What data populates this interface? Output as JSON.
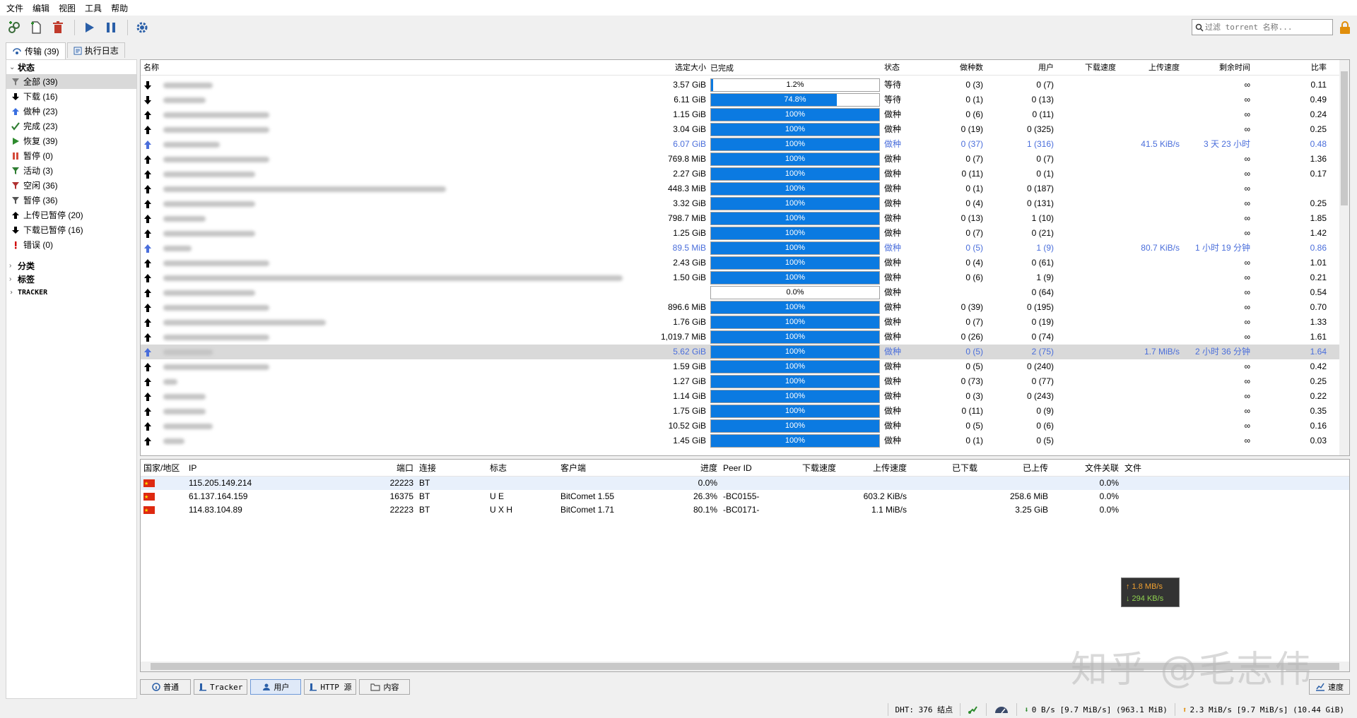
{
  "menu": [
    "文件",
    "编辑",
    "视图",
    "工具",
    "帮助"
  ],
  "toolbar": {
    "icons": [
      "add-link-icon",
      "add-file-icon",
      "delete-icon",
      "play-icon",
      "pause-icon",
      "gear-icon"
    ],
    "filter_placeholder": "过滤 torrent 名称..."
  },
  "top_tabs": [
    {
      "label": "传输 (39)",
      "icon": "transfer-icon"
    },
    {
      "label": "执行日志",
      "icon": "log-icon"
    }
  ],
  "sidebar": {
    "status_group": "状态",
    "status_items": [
      {
        "label": "全部 (39)",
        "icon": "filter-icon",
        "color": "#7a7a7a"
      },
      {
        "label": "下载 (16)",
        "icon": "download-arrow-icon",
        "color": "#000000"
      },
      {
        "label": "做种 (23)",
        "icon": "upload-arrow-icon",
        "color": "#3a6fe0"
      },
      {
        "label": "完成 (23)",
        "icon": "checkmark-icon",
        "color": "#2f7d32"
      },
      {
        "label": "恢复 (39)",
        "icon": "play-icon",
        "color": "#2e8b2e"
      },
      {
        "label": "暂停 (0)",
        "icon": "pause-icon",
        "color": "#d44a3a"
      },
      {
        "label": "活动 (3)",
        "icon": "filter-icon",
        "color": "#2e7d32"
      },
      {
        "label": "空闲 (36)",
        "icon": "filter-icon",
        "color": "#b03030"
      },
      {
        "label": "暂停 (36)",
        "icon": "filter-icon",
        "color": "#555555"
      },
      {
        "label": "上传已暂停 (20)",
        "icon": "upload-arrow-icon",
        "color": "#000000"
      },
      {
        "label": "下载已暂停 (16)",
        "icon": "download-arrow-icon",
        "color": "#000000"
      },
      {
        "label": "错误 (0)",
        "icon": "error-icon",
        "color": "#d00000"
      }
    ],
    "groups": [
      "分类",
      "标签",
      "TRACKER"
    ]
  },
  "torrent_table": {
    "columns": [
      "名称",
      "选定大小",
      "已完成",
      "状态",
      "做种数",
      "用户",
      "下载速度",
      "上传速度",
      "剩余时间",
      "比率"
    ],
    "rows": [
      {
        "dir": "down",
        "size": "3.57 GiB",
        "progress": 0.012,
        "progress_label": "1.2%",
        "state": "等待",
        "seeds": "0 (3)",
        "peers": "0 (7)",
        "dl": "",
        "ul": "",
        "eta": "∞",
        "ratio": "0.11",
        "active": false,
        "selected": false
      },
      {
        "dir": "down",
        "size": "6.11 GiB",
        "progress": 0.748,
        "progress_label": "74.8%",
        "state": "等待",
        "seeds": "0 (1)",
        "peers": "0 (13)",
        "dl": "",
        "ul": "",
        "eta": "∞",
        "ratio": "0.49",
        "active": false,
        "selected": false
      },
      {
        "dir": "up",
        "size": "1.15 GiB",
        "progress": 1,
        "progress_label": "100%",
        "state": "做种",
        "seeds": "0 (6)",
        "peers": "0 (11)",
        "dl": "",
        "ul": "",
        "eta": "∞",
        "ratio": "0.24",
        "active": false,
        "selected": false
      },
      {
        "dir": "up",
        "size": "3.04 GiB",
        "progress": 1,
        "progress_label": "100%",
        "state": "做种",
        "seeds": "0 (19)",
        "peers": "0 (325)",
        "dl": "",
        "ul": "",
        "eta": "∞",
        "ratio": "0.25",
        "active": false,
        "selected": false
      },
      {
        "dir": "up",
        "size": "6.07 GiB",
        "progress": 1,
        "progress_label": "100%",
        "state": "做种",
        "seeds": "0 (37)",
        "peers": "1 (316)",
        "dl": "",
        "ul": "41.5 KiB/s",
        "eta": "3 天 23 小时",
        "ratio": "0.48",
        "active": true,
        "selected": false
      },
      {
        "dir": "up",
        "size": "769.8 MiB",
        "progress": 1,
        "progress_label": "100%",
        "state": "做种",
        "seeds": "0 (7)",
        "peers": "0 (7)",
        "dl": "",
        "ul": "",
        "eta": "∞",
        "ratio": "1.36",
        "active": false,
        "selected": false
      },
      {
        "dir": "up",
        "size": "2.27 GiB",
        "progress": 1,
        "progress_label": "100%",
        "state": "做种",
        "seeds": "0 (11)",
        "peers": "0 (1)",
        "dl": "",
        "ul": "",
        "eta": "∞",
        "ratio": "0.17",
        "active": false,
        "selected": false
      },
      {
        "dir": "up",
        "size": "448.3 MiB",
        "progress": 1,
        "progress_label": "100%",
        "state": "做种",
        "seeds": "0 (1)",
        "peers": "0 (187)",
        "dl": "",
        "ul": "",
        "eta": "∞",
        "ratio": "",
        "active": false,
        "selected": false
      },
      {
        "dir": "up",
        "size": "3.32 GiB",
        "progress": 1,
        "progress_label": "100%",
        "state": "做种",
        "seeds": "0 (4)",
        "peers": "0 (131)",
        "dl": "",
        "ul": "",
        "eta": "∞",
        "ratio": "0.25",
        "active": false,
        "selected": false
      },
      {
        "dir": "up",
        "size": "798.7 MiB",
        "progress": 1,
        "progress_label": "100%",
        "state": "做种",
        "seeds": "0 (13)",
        "peers": "1 (10)",
        "dl": "",
        "ul": "",
        "eta": "∞",
        "ratio": "1.85",
        "active": false,
        "selected": false
      },
      {
        "dir": "up",
        "size": "1.25 GiB",
        "progress": 1,
        "progress_label": "100%",
        "state": "做种",
        "seeds": "0 (7)",
        "peers": "0 (21)",
        "dl": "",
        "ul": "",
        "eta": "∞",
        "ratio": "1.42",
        "active": false,
        "selected": false
      },
      {
        "dir": "up",
        "size": "89.5 MiB",
        "progress": 1,
        "progress_label": "100%",
        "state": "做种",
        "seeds": "0 (5)",
        "peers": "1 (9)",
        "dl": "",
        "ul": "80.7 KiB/s",
        "eta": "1 小时 19 分钟",
        "ratio": "0.86",
        "active": true,
        "selected": false
      },
      {
        "dir": "up",
        "size": "2.43 GiB",
        "progress": 1,
        "progress_label": "100%",
        "state": "做种",
        "seeds": "0 (4)",
        "peers": "0 (61)",
        "dl": "",
        "ul": "",
        "eta": "∞",
        "ratio": "1.01",
        "active": false,
        "selected": false
      },
      {
        "dir": "up",
        "size": "1.50 GiB",
        "progress": 1,
        "progress_label": "100%",
        "state": "做种",
        "seeds": "0 (6)",
        "peers": "1 (9)",
        "dl": "",
        "ul": "",
        "eta": "∞",
        "ratio": "0.21",
        "active": false,
        "selected": false
      },
      {
        "dir": "up",
        "size": "",
        "progress": 0,
        "progress_label": "0.0%",
        "state": "做种",
        "seeds": "",
        "peers": "0 (64)",
        "dl": "",
        "ul": "",
        "eta": "∞",
        "ratio": "0.54",
        "active": false,
        "selected": false
      },
      {
        "dir": "up",
        "size": "896.6 MiB",
        "progress": 1,
        "progress_label": "100%",
        "state": "做种",
        "seeds": "0 (39)",
        "peers": "0 (195)",
        "dl": "",
        "ul": "",
        "eta": "∞",
        "ratio": "0.70",
        "active": false,
        "selected": false
      },
      {
        "dir": "up",
        "size": "1.76 GiB",
        "progress": 1,
        "progress_label": "100%",
        "state": "做种",
        "seeds": "0 (7)",
        "peers": "0 (19)",
        "dl": "",
        "ul": "",
        "eta": "∞",
        "ratio": "1.33",
        "active": false,
        "selected": false
      },
      {
        "dir": "up",
        "size": "1,019.7 MiB",
        "progress": 1,
        "progress_label": "100%",
        "state": "做种",
        "seeds": "0 (26)",
        "peers": "0 (74)",
        "dl": "",
        "ul": "",
        "eta": "∞",
        "ratio": "1.61",
        "active": false,
        "selected": false
      },
      {
        "dir": "up",
        "size": "5.62 GiB",
        "progress": 1,
        "progress_label": "100%",
        "state": "做种",
        "seeds": "0 (5)",
        "peers": "2 (75)",
        "dl": "",
        "ul": "1.7 MiB/s",
        "eta": "2 小时 36 分钟",
        "ratio": "1.64",
        "active": true,
        "selected": true
      },
      {
        "dir": "up",
        "size": "1.59 GiB",
        "progress": 1,
        "progress_label": "100%",
        "state": "做种",
        "seeds": "0 (5)",
        "peers": "0 (240)",
        "dl": "",
        "ul": "",
        "eta": "∞",
        "ratio": "0.42",
        "active": false,
        "selected": false
      },
      {
        "dir": "up",
        "size": "1.27 GiB",
        "progress": 1,
        "progress_label": "100%",
        "state": "做种",
        "seeds": "0 (73)",
        "peers": "0 (77)",
        "dl": "",
        "ul": "",
        "eta": "∞",
        "ratio": "0.25",
        "active": false,
        "selected": false
      },
      {
        "dir": "up",
        "size": "1.14 GiB",
        "progress": 1,
        "progress_label": "100%",
        "state": "做种",
        "seeds": "0 (3)",
        "peers": "0 (243)",
        "dl": "",
        "ul": "",
        "eta": "∞",
        "ratio": "0.22",
        "active": false,
        "selected": false
      },
      {
        "dir": "up",
        "size": "1.75 GiB",
        "progress": 1,
        "progress_label": "100%",
        "state": "做种",
        "seeds": "0 (11)",
        "peers": "0 (9)",
        "dl": "",
        "ul": "",
        "eta": "∞",
        "ratio": "0.35",
        "active": false,
        "selected": false
      },
      {
        "dir": "up",
        "size": "10.52 GiB",
        "progress": 1,
        "progress_label": "100%",
        "state": "做种",
        "seeds": "0 (5)",
        "peers": "0 (6)",
        "dl": "",
        "ul": "",
        "eta": "∞",
        "ratio": "0.16",
        "active": false,
        "selected": false
      },
      {
        "dir": "up",
        "size": "1.45 GiB",
        "progress": 1,
        "progress_label": "100%",
        "state": "做种",
        "seeds": "0 (1)",
        "peers": "0 (5)",
        "dl": "",
        "ul": "",
        "eta": "∞",
        "ratio": "0.03",
        "active": false,
        "selected": false
      }
    ]
  },
  "peer_table": {
    "columns": [
      "国家/地区",
      "IP",
      "端口",
      "连接",
      "标志",
      "客户端",
      "进度",
      "Peer ID",
      "下载速度",
      "上传速度",
      "已下载",
      "已上传",
      "文件关联",
      "文件"
    ],
    "rows": [
      {
        "ip": "115.205.149.214",
        "port": "22223",
        "conn": "BT",
        "flags": "",
        "client": "",
        "progress": "0.0%",
        "peer_id": "",
        "dl_speed": "",
        "ul_speed": "",
        "downloaded": "",
        "uploaded": "",
        "relevance": "0.0%",
        "files": ""
      },
      {
        "ip": "61.137.164.159",
        "port": "16375",
        "conn": "BT",
        "flags": "U E",
        "client": "BitComet 1.55",
        "progress": "26.3%",
        "peer_id": "-BC0155-",
        "dl_speed": "",
        "ul_speed": "603.2 KiB/s",
        "downloaded": "",
        "uploaded": "258.6 MiB",
        "relevance": "0.0%",
        "files": ""
      },
      {
        "ip": "114.83.104.89",
        "port": "22223",
        "conn": "BT",
        "flags": "U X H",
        "client": "BitComet 1.71",
        "progress": "80.1%",
        "peer_id": "-BC0171-",
        "dl_speed": "",
        "ul_speed": "1.1 MiB/s",
        "downloaded": "",
        "uploaded": "3.25 GiB",
        "relevance": "0.0%",
        "files": ""
      }
    ]
  },
  "speed_popup": {
    "up": "↑ 1.8 MB/s",
    "down": "↓ 294 KB/s"
  },
  "watermark": "知乎 @毛志伟",
  "bottom_tabs": [
    {
      "label": "普通",
      "icon": "general-icon"
    },
    {
      "label": "Tracker",
      "icon": "tracker-icon"
    },
    {
      "label": "用户",
      "icon": "users-icon",
      "active": true
    },
    {
      "label": "HTTP 源",
      "icon": "http-source-icon"
    },
    {
      "label": "内容",
      "icon": "folder-icon"
    }
  ],
  "speed_tab": "速度",
  "statusbar": {
    "dht": "DHT: 376 结点",
    "download": "0 B/s [9.7 MiB/s] (963.1 MiB)",
    "upload": "2.3 MiB/s [9.7 MiB/s] (10.44 GiB)"
  }
}
